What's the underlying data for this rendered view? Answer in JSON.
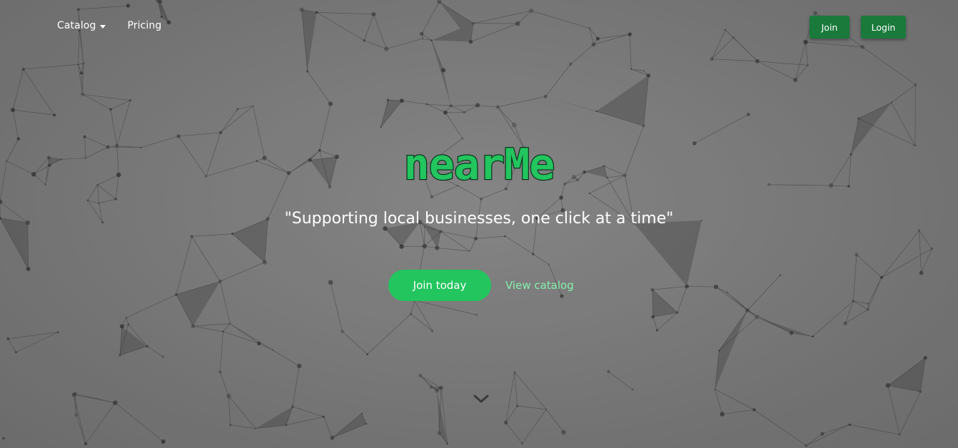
{
  "nav": {
    "catalog_label": "Catalog",
    "pricing_label": "Pricing",
    "join_label": "Join",
    "login_label": "Login"
  },
  "hero": {
    "brand": "nearMe",
    "tagline": "\"Supporting local businesses, one click at a time\"",
    "cta_primary": "Join today",
    "cta_secondary": "View catalog"
  },
  "icons": {
    "catalog_dropdown": "caret-down-icon",
    "scroll": "chevron-down-icon"
  },
  "colors": {
    "brand_green": "#22c55e",
    "dark_button": "#1a7a3c",
    "secondary_link": "#86efac"
  }
}
